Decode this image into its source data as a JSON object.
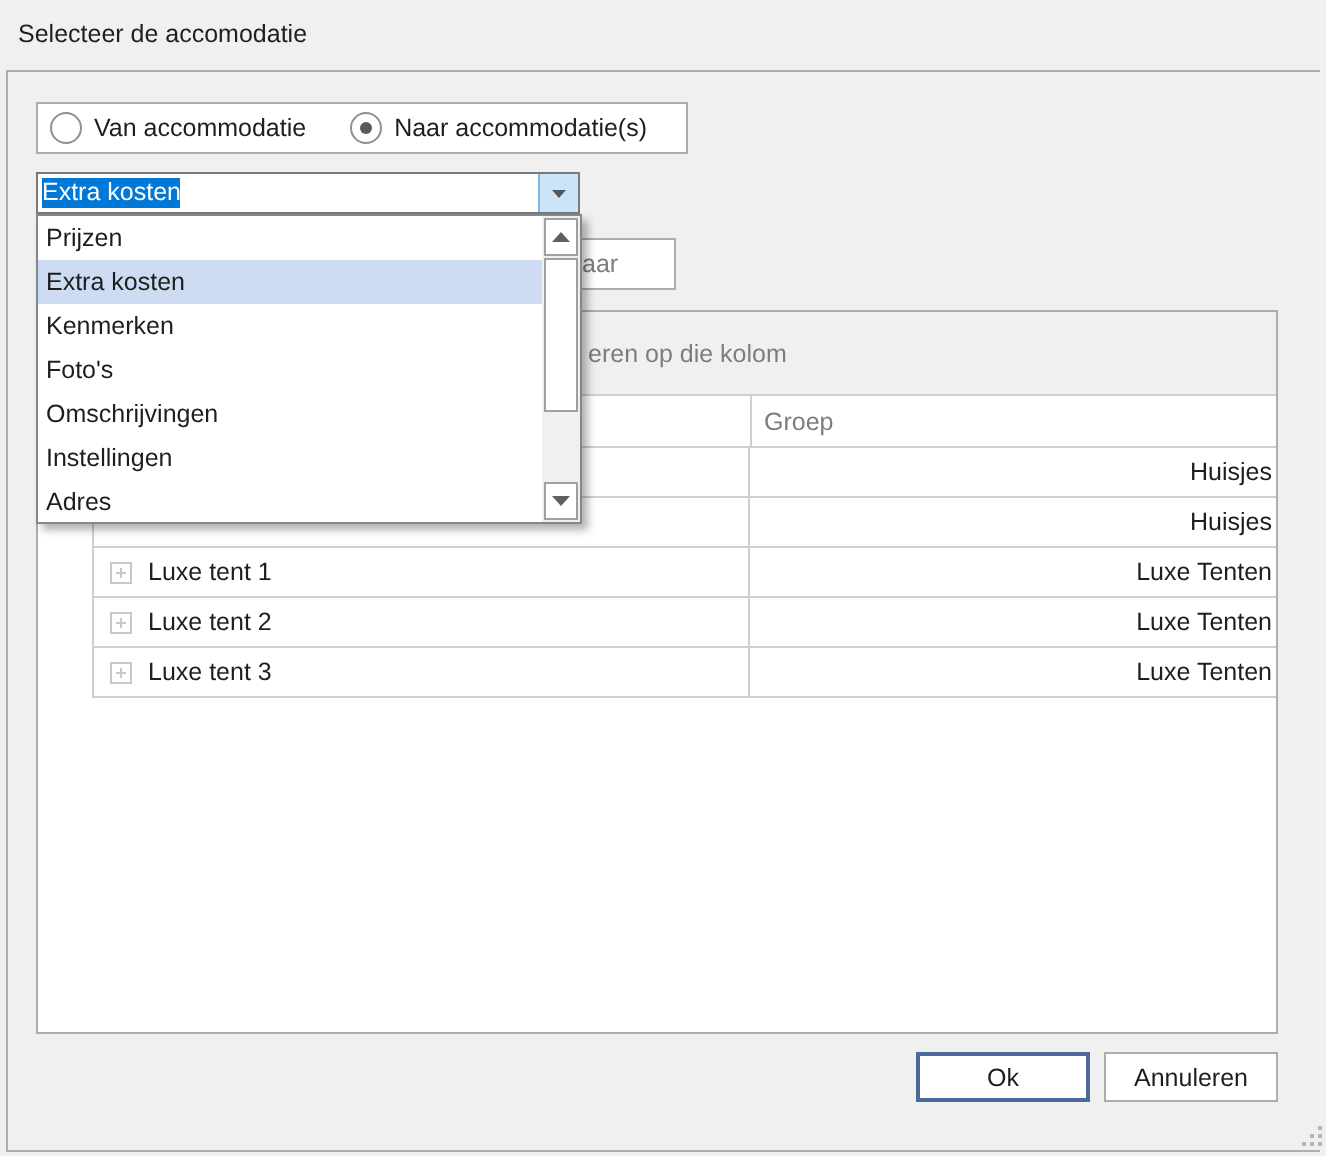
{
  "window": {
    "title": "Selecteer de accomodatie"
  },
  "direction": [
    {
      "label": "Van accommodatie",
      "selected": false
    },
    {
      "label": "Naar accommodatie(s)",
      "selected": true
    }
  ],
  "category": {
    "value": "Extra kosten",
    "open": true,
    "options": [
      {
        "label": "Prijzen",
        "selected": false
      },
      {
        "label": "Extra kosten",
        "selected": true
      },
      {
        "label": "Kenmerken",
        "selected": false
      },
      {
        "label": "Foto's",
        "selected": false
      },
      {
        "label": "Omschrijvingen",
        "selected": false
      },
      {
        "label": "Instellingen",
        "selected": false
      },
      {
        "label": "Adres",
        "selected": false
      }
    ]
  },
  "partial_button": {
    "label": "aar"
  },
  "group_panel": {
    "hint": "eren op die kolom"
  },
  "grid": {
    "columns": [
      {
        "label": "Groep"
      }
    ],
    "rows": [
      {
        "group": "Huisjes"
      },
      {
        "group": "Huisjes"
      },
      {
        "name": "Luxe tent 1",
        "group": "Luxe Tenten"
      },
      {
        "name": "Luxe tent 2",
        "group": "Luxe Tenten"
      },
      {
        "name": "Luxe tent 3",
        "group": "Luxe Tenten"
      }
    ]
  },
  "buttons": [
    {
      "label": "Ok",
      "default": true
    },
    {
      "label": "Annuleren",
      "default": false
    }
  ]
}
